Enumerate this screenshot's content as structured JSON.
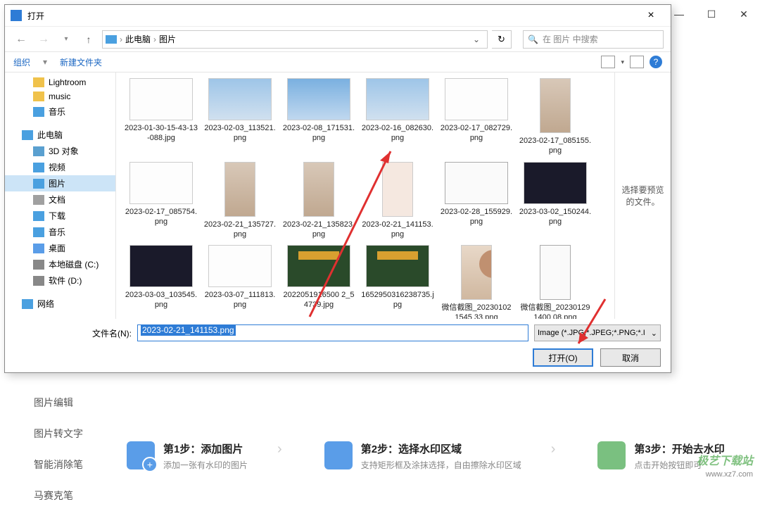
{
  "bg": {
    "sidebar": [
      "图片编辑",
      "图片转文字",
      "智能消除笔",
      "马赛克笔"
    ],
    "steps": [
      {
        "title": "第1步：添加图片",
        "sub": "添加一张有水印的图片"
      },
      {
        "title": "第2步：选择水印区域",
        "sub": "支持矩形框及涂抹选择，自由擦除水印区域"
      },
      {
        "title": "第3步：开始去水印",
        "sub": "点击开始按钮即可"
      }
    ],
    "watermark": "极艺下载站",
    "watermark_url": "www.xz7.com"
  },
  "dialog": {
    "title": "打开",
    "breadcrumb": {
      "root": "此电脑",
      "folder": "图片"
    },
    "search_placeholder": "在 图片 中搜索",
    "toolbar": {
      "organize": "组织",
      "newfolder": "新建文件夹"
    },
    "tree": [
      {
        "label": "Lightroom",
        "icon": "folder",
        "lvl": 2
      },
      {
        "label": "music",
        "icon": "folder",
        "lvl": 2
      },
      {
        "label": "音乐",
        "icon": "music",
        "lvl": 2
      },
      {
        "label": "此电脑",
        "icon": "pc",
        "lvl": 1,
        "spacer": true
      },
      {
        "label": "3D 对象",
        "icon": "obj3d",
        "lvl": 2
      },
      {
        "label": "视频",
        "icon": "vid",
        "lvl": 2
      },
      {
        "label": "图片",
        "icon": "img",
        "lvl": 2,
        "sel": true
      },
      {
        "label": "文档",
        "icon": "doc",
        "lvl": 2
      },
      {
        "label": "下载",
        "icon": "dl",
        "lvl": 2
      },
      {
        "label": "音乐",
        "icon": "music",
        "lvl": 2
      },
      {
        "label": "桌面",
        "icon": "desk",
        "lvl": 2
      },
      {
        "label": "本地磁盘 (C:)",
        "icon": "drive",
        "lvl": 2
      },
      {
        "label": "软件 (D:)",
        "icon": "drive",
        "lvl": 2
      },
      {
        "label": "网络",
        "icon": "net",
        "lvl": 1,
        "spacer": true
      }
    ],
    "files": [
      {
        "name": "2023-01-30-15-43-13-088.jpg",
        "cls": "white"
      },
      {
        "name": "2023-02-03_113521.png",
        "cls": "sky"
      },
      {
        "name": "2023-02-08_171531.png",
        "cls": "sky2"
      },
      {
        "name": "2023-02-16_082630.png",
        "cls": "sky"
      },
      {
        "name": "2023-02-17_082729.png",
        "cls": "white"
      },
      {
        "name": "2023-02-17_085155.png",
        "cls": "person portrait"
      },
      {
        "name": "2023-02-17_085754.png",
        "cls": "white"
      },
      {
        "name": "2023-02-21_135727.png",
        "cls": "person portrait"
      },
      {
        "name": "2023-02-21_135823.png",
        "cls": "person portrait"
      },
      {
        "name": "2023-02-21_141153.png",
        "cls": "pink portrait"
      },
      {
        "name": "2023-02-28_155929.png",
        "cls": "app"
      },
      {
        "name": "2023-03-02_150244.png",
        "cls": "dark"
      },
      {
        "name": "2023-03-03_103545.png",
        "cls": "dark"
      },
      {
        "name": "2023-03-07_111813.png",
        "cls": "white"
      },
      {
        "name": "2022051916500 2_54739.jpg",
        "cls": "game"
      },
      {
        "name": "1652950316238735.jpg",
        "cls": "game"
      },
      {
        "name": "微信截图_202301021545 33.png",
        "cls": "lady portrait"
      },
      {
        "name": "微信截图_202301291400 08.png",
        "cls": "app portrait"
      }
    ],
    "preview_hint": "选择要预览的文件。",
    "filename_label": "文件名(N):",
    "filename_value": "2023-02-21_141153.png",
    "filetype": "Image (*.JPG;*.JPEG;*.PNG;*.I",
    "open_btn": "打开(O)",
    "cancel_btn": "取消"
  }
}
